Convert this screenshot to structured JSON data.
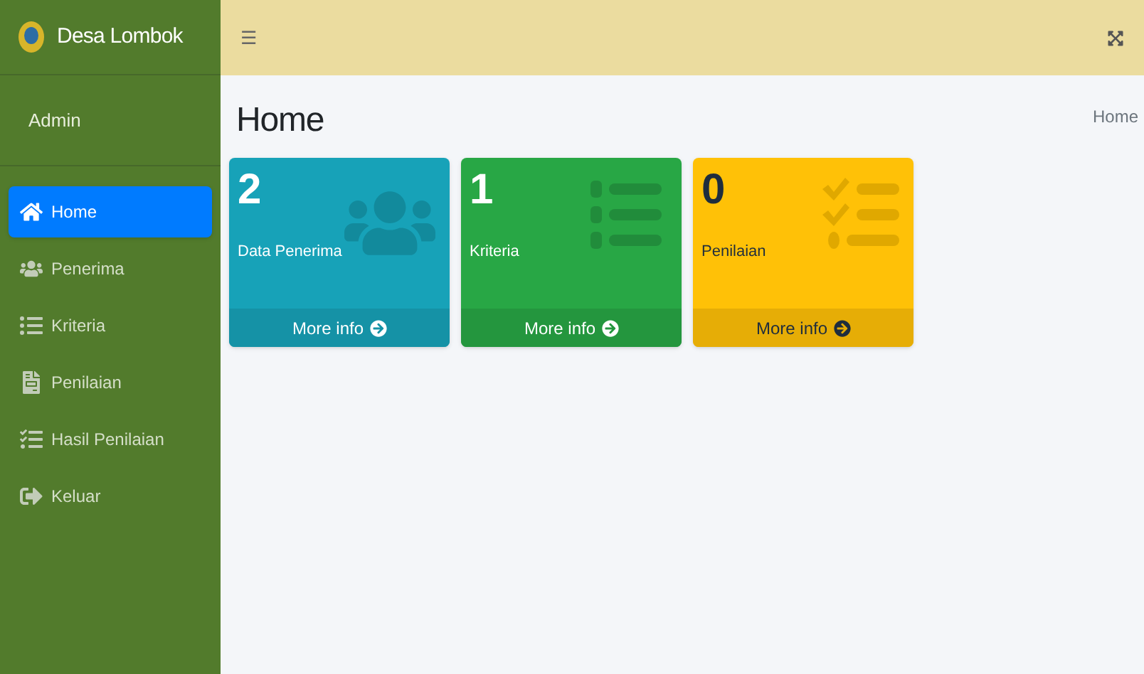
{
  "brand": {
    "title": "Desa Lombok"
  },
  "user": {
    "name": "Admin"
  },
  "sidebar": {
    "items": [
      {
        "label": "Home",
        "selected": true
      },
      {
        "label": "Penerima",
        "selected": false
      },
      {
        "label": "Kriteria",
        "selected": false
      },
      {
        "label": "Penilaian",
        "selected": false
      },
      {
        "label": "Hasil Penilaian",
        "selected": false
      },
      {
        "label": "Keluar",
        "selected": false
      }
    ]
  },
  "topbar": {
    "menu_glyph": "☰"
  },
  "page": {
    "title": "Home",
    "breadcrumb": "Home"
  },
  "cards": [
    {
      "kind": "info",
      "value": "2",
      "label": "Data Penerima",
      "link": "More info"
    },
    {
      "kind": "success",
      "value": "1",
      "label": "Kriteria",
      "link": "More info"
    },
    {
      "kind": "warning",
      "value": "0",
      "label": "Penilaian",
      "link": "More info"
    }
  ]
}
